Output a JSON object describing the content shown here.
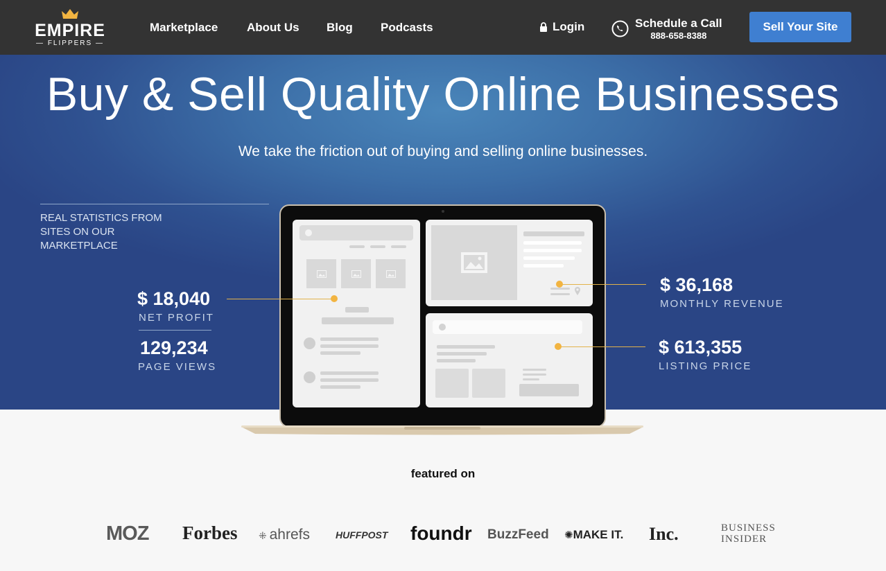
{
  "nav": {
    "logo_main": "EMPIRE",
    "logo_sub": "— FLIPPERS —",
    "links": [
      "Marketplace",
      "About Us",
      "Blog",
      "Podcasts"
    ],
    "login": "Login",
    "schedule_label": "Schedule a Call",
    "phone": "888-658-8388",
    "cta": "Sell Your Site"
  },
  "hero": {
    "title": "Buy & Sell Quality Online Businesses",
    "subtitle": "We take the friction out of buying and selling online businesses.",
    "stats_heading": "REAL STATISTICS FROM SITES ON OUR MARKETPLACE",
    "stats": {
      "net_profit_value": "$ 18,040",
      "net_profit_label": "NET PROFIT",
      "page_views_value": "129,234",
      "page_views_label": "PAGE VIEWS",
      "monthly_revenue_value": "$ 36,168",
      "monthly_revenue_label": "MONTHLY REVENUE",
      "listing_price_value": "$ 613,355",
      "listing_price_label": "LISTING PRICE"
    }
  },
  "featured": {
    "heading": "featured on",
    "brands": [
      "MOZ",
      "Forbes",
      "ahrefs",
      "HUFFPOST",
      "foundr",
      "BuzzFeed",
      "MAKE IT.",
      "Inc.",
      "BUSINESS INSIDER"
    ]
  },
  "colors": {
    "nav_bg": "#333333",
    "cta_bg": "#3f7fd1",
    "hero_blue": "#2f5190",
    "accent_gold": "#f2b441"
  },
  "icons": [
    "crown-icon",
    "lock-icon",
    "phone-icon",
    "image-placeholder-icon",
    "avatar-placeholder-icon",
    "location-pin-icon"
  ]
}
